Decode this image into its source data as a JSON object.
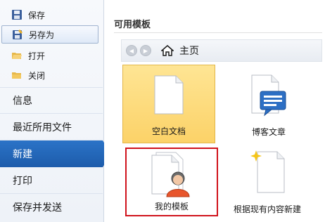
{
  "sidebar": {
    "small_items": [
      {
        "label": "保存",
        "icon": "save-icon"
      },
      {
        "label": "另存为",
        "icon": "save-as-icon",
        "selected": true
      },
      {
        "label": "打开",
        "icon": "open-folder-icon"
      },
      {
        "label": "关闭",
        "icon": "close-folder-icon"
      }
    ],
    "big_items": [
      {
        "label": "信息"
      },
      {
        "label": "最近所用文件"
      },
      {
        "label": "新建",
        "active": true
      },
      {
        "label": "打印"
      },
      {
        "label": "保存并发送"
      }
    ]
  },
  "main": {
    "heading": "可用模板",
    "breadcrumb": "主页",
    "tiles": [
      {
        "label": "空白文档",
        "icon": "blank-document-icon",
        "selected": true
      },
      {
        "label": "博客文章",
        "icon": "blog-post-icon"
      },
      {
        "label": "我的模板",
        "icon": "my-templates-icon",
        "highlighted": true
      },
      {
        "label": "根据现有内容新建",
        "icon": "new-from-existing-icon"
      }
    ]
  },
  "colors": {
    "active_nav": "#1d5cab",
    "selected_tile": "#fcd268",
    "highlight_border": "#d0121b"
  }
}
